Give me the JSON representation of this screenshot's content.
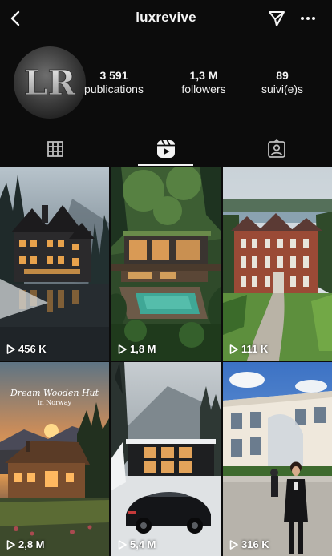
{
  "header": {
    "username": "luxrevive"
  },
  "profile": {
    "avatar_initials": "LR",
    "stats": [
      {
        "value": "3 591",
        "label": "publications"
      },
      {
        "value": "1,3 M",
        "label": "followers"
      },
      {
        "value": "89",
        "label": "suivi(e)s"
      }
    ]
  },
  "tabs": [
    {
      "icon": "grid-icon",
      "active": false
    },
    {
      "icon": "reels-icon",
      "active": true
    },
    {
      "icon": "tagged-icon",
      "active": false
    }
  ],
  "posts": [
    {
      "views": "456 K",
      "scene": "dark mansion by lake in misty forest"
    },
    {
      "views": "1,8 M",
      "scene": "modern house with pool in forest"
    },
    {
      "views": "111 K",
      "scene": "red brick manor by river"
    },
    {
      "views": "2,8 M",
      "scene": "wooden hut at sunset",
      "overlay_title": "Dream Wooden Hut",
      "overlay_subtitle": "in Norway"
    },
    {
      "views": "5,4 M",
      "scene": "black modern house with sports car in snow"
    },
    {
      "views": "316 K",
      "scene": "woman in front of modern building"
    }
  ],
  "colors": {
    "background": "#0c0c0c",
    "text": "#f5f5f5"
  }
}
